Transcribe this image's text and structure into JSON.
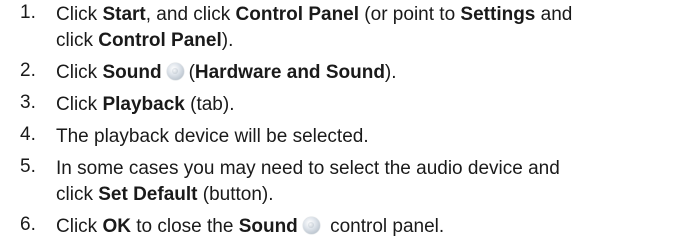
{
  "steps": [
    {
      "num": "1.",
      "parts": {
        "a": "Click ",
        "b": "Start",
        "c": ", and click ",
        "d": "Control Panel",
        "e": " (or point to ",
        "f": "Settings",
        "g": " and",
        "h": "click ",
        "i": "Control Panel",
        "j": ")."
      }
    },
    {
      "num": "2.",
      "parts": {
        "a": "Click ",
        "b": "Sound",
        "c": "(",
        "d": "Hardware and Sound",
        "e": ")."
      }
    },
    {
      "num": "3.",
      "parts": {
        "a": "Click ",
        "b": "Playback",
        "c": " (tab)."
      }
    },
    {
      "num": "4.",
      "text": "The playback device will be selected."
    },
    {
      "num": "5.",
      "parts": {
        "a": "In some cases you may need to select the audio device and",
        "b": "click ",
        "c": "Set Default",
        "d": " (button)."
      }
    },
    {
      "num": "6.",
      "parts": {
        "a": "Click ",
        "b": "OK",
        "c": " to close the ",
        "d": "Sound",
        "e": " control panel."
      }
    }
  ],
  "icons": {
    "sound": "sound-icon"
  }
}
